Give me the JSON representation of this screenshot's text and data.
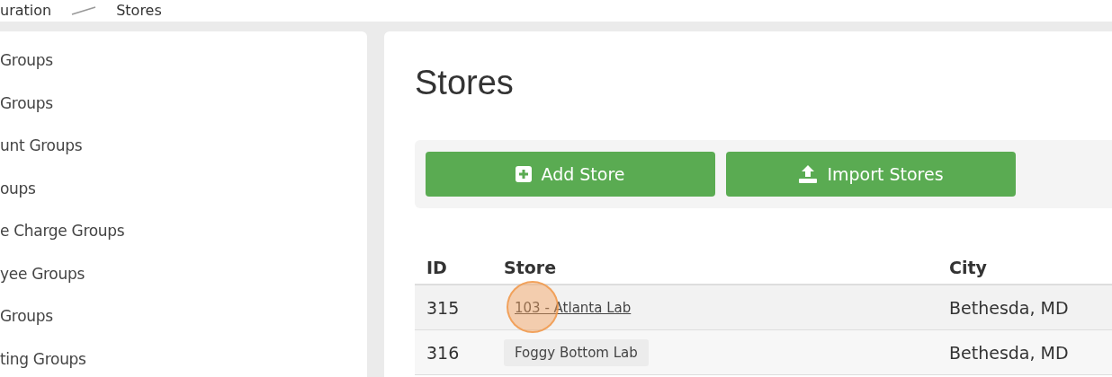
{
  "breadcrumb": [
    {
      "label": "uration"
    },
    {
      "label": "Stores"
    }
  ],
  "sidebar": {
    "items": [
      {
        "label": "Groups"
      },
      {
        "label": "Groups"
      },
      {
        "label": "unt Groups"
      },
      {
        "label": "oups"
      },
      {
        "label": "e Charge Groups"
      },
      {
        "label": "yee Groups"
      },
      {
        "label": "Groups"
      },
      {
        "label": "ting Groups"
      }
    ]
  },
  "page": {
    "title": "Stores"
  },
  "toolbar": {
    "buttons": [
      {
        "label": "Add Store",
        "kind": "add"
      },
      {
        "label": "Import Stores",
        "kind": "import"
      }
    ]
  },
  "table": {
    "columns": [
      "ID",
      "Store",
      "City"
    ],
    "rows": [
      {
        "id": "315",
        "store": "103 - Atlanta Lab",
        "city": "Bethesda, MD",
        "hovered": true
      },
      {
        "id": "316",
        "store": "Foggy Bottom Lab",
        "city": "Bethesda, MD",
        "hovered": false
      }
    ]
  }
}
